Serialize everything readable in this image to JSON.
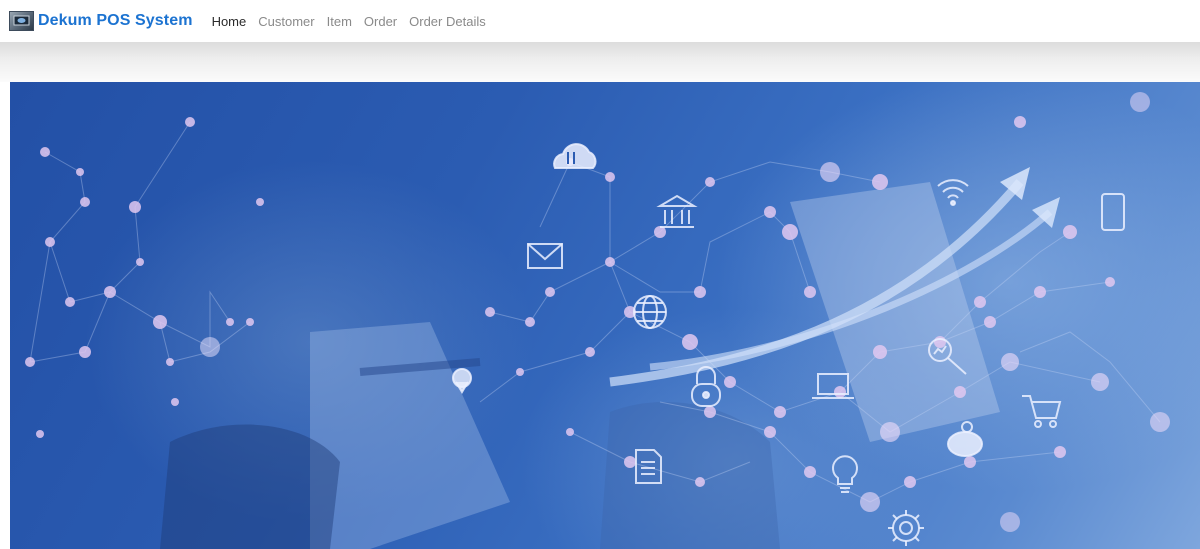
{
  "brand": {
    "name": "Dekum POS System",
    "logo_icon": "computer-screen-icon"
  },
  "nav": {
    "items": [
      {
        "label": "Home",
        "active": true
      },
      {
        "label": "Customer",
        "active": false
      },
      {
        "label": "Item",
        "active": false
      },
      {
        "label": "Order",
        "active": false
      },
      {
        "label": "Order Details",
        "active": false
      }
    ]
  },
  "hero": {
    "description_icons": [
      "cloud-transfer-icon",
      "bank-icon",
      "wifi-icon",
      "mail-icon",
      "globe-icon",
      "location-pin-icon",
      "padlock-icon",
      "laptop-icon",
      "magnifier-chart-icon",
      "shopping-cart-icon",
      "piggy-bank-icon",
      "document-icon",
      "lightbulb-icon",
      "gear-icon",
      "smartphone-icon",
      "growth-arrow-icon"
    ]
  },
  "colors": {
    "brand": "#1c73d1",
    "nav_active": "#2b2b2b",
    "nav_inactive": "#8a8a8a",
    "hero_base": "#2b5cb2"
  }
}
